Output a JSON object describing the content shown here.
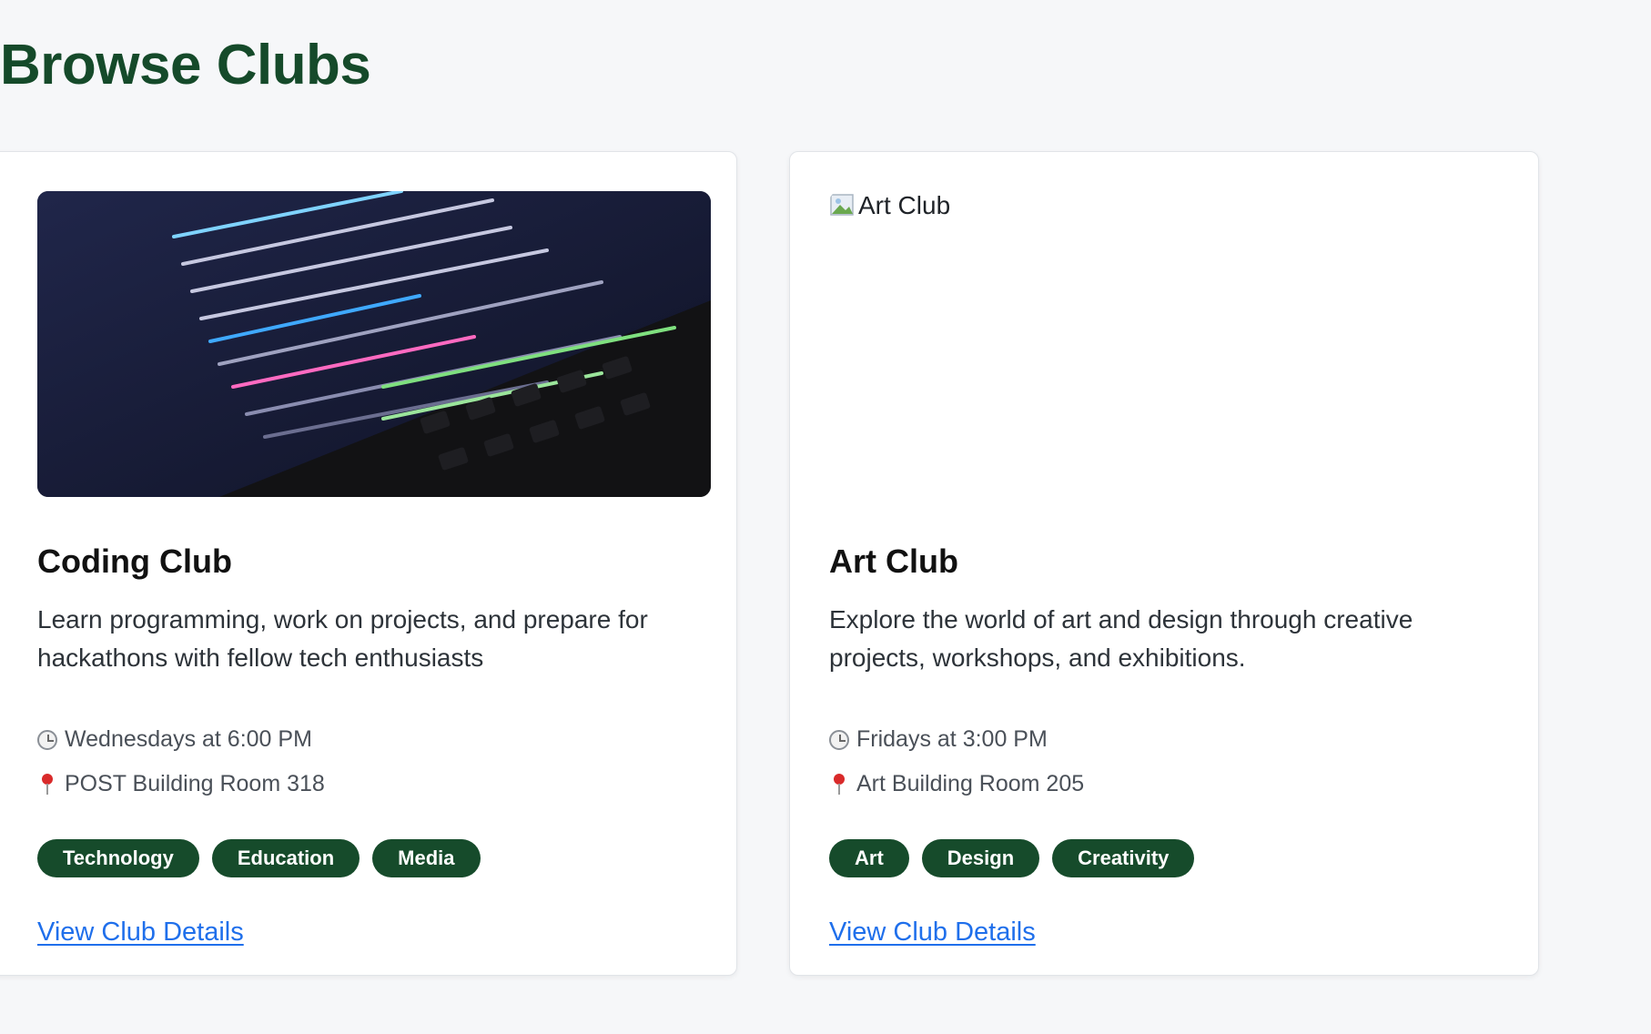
{
  "page": {
    "title": "Browse Clubs"
  },
  "clubs": [
    {
      "name": "Coding Club",
      "image_alt": "Coding Club",
      "description": "Learn programming, work on projects, and prepare for hackathons with fellow tech enthusiasts",
      "schedule": "Wednesdays at 6:00 PM",
      "location": "POST Building Room 318",
      "tags": [
        "Technology",
        "Education",
        "Media"
      ],
      "link_label": "View Club Details"
    },
    {
      "name": "Art Club",
      "image_alt": "Art Club",
      "description": "Explore the world of art and design through creative projects, workshops, and exhibitions.",
      "schedule": "Fridays at 3:00 PM",
      "location": "Art Building Room 205",
      "tags": [
        "Art",
        "Design",
        "Creativity"
      ],
      "link_label": "View Club Details"
    }
  ],
  "icons": {
    "schedule": "clock-icon",
    "location": "pushpin-icon"
  },
  "colors": {
    "title": "#154a2a",
    "tag_bg": "#164b2b",
    "link": "#1f6feb"
  }
}
